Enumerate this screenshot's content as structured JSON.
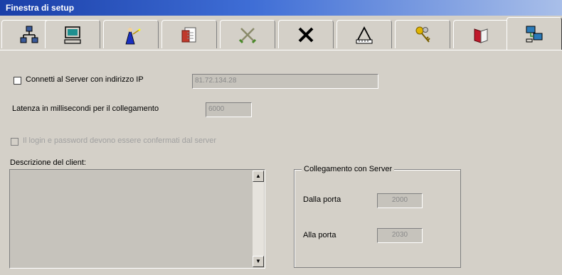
{
  "window": {
    "title": "Finestra di setup"
  },
  "tabs": [
    {
      "icon": "network-icon"
    },
    {
      "icon": "monitor-icon"
    },
    {
      "icon": "wizard-icon"
    },
    {
      "icon": "document-icon"
    },
    {
      "icon": "crossed-swords-icon"
    },
    {
      "icon": "close-x-icon"
    },
    {
      "icon": "ruler-icon"
    },
    {
      "icon": "keys-icon"
    },
    {
      "icon": "book-icon"
    },
    {
      "icon": "network-computers-icon",
      "active": true
    }
  ],
  "form": {
    "connect_label": "Connetti al Server con indirizzo IP",
    "connect_checked": false,
    "ip_value": "81.72.134.28",
    "latency_label": "Latenza in millisecondi per il collegamento",
    "latency_value": "6000",
    "confirm_label": "Il login e password devono essere confermati dal server",
    "confirm_checked": false,
    "confirm_disabled": true,
    "description_label": "Descrizione del client:",
    "description_value": ""
  },
  "server_group": {
    "title": "Collegamento con Server",
    "from_port_label": "Dalla porta",
    "from_port_value": "2000",
    "to_port_label": "Alla porta",
    "to_port_value": "2030"
  },
  "colors": {
    "title_gradient_start": "#1a3fa8",
    "title_gradient_end": "#a9bfe9",
    "panel_bg": "#d4d0c8"
  }
}
